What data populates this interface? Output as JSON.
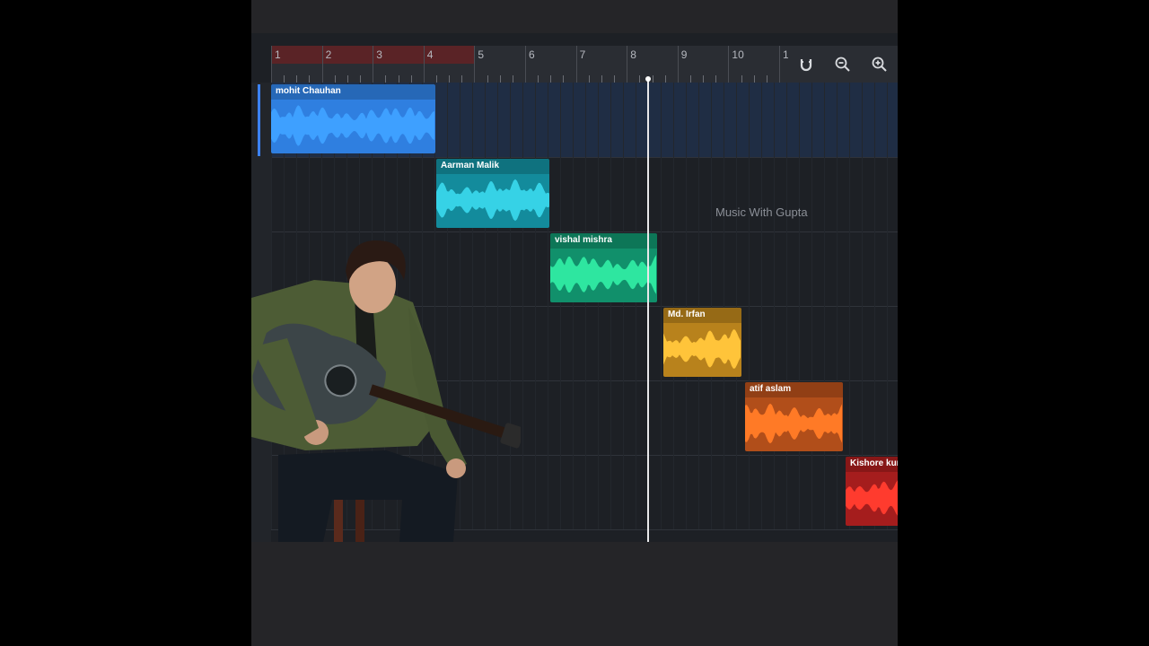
{
  "ruler": {
    "bars": [
      "1",
      "2",
      "3",
      "4",
      "5",
      "6",
      "7",
      "8",
      "9",
      "10",
      "11"
    ]
  },
  "tools": {
    "magnet_icon": "magnet-icon",
    "zoom_out_icon": "zoom-out-icon",
    "zoom_in_icon": "zoom-in-icon"
  },
  "watermark": "Music With Gupta",
  "playhead": {
    "bar": 8.4
  },
  "tracks": [
    {
      "name": "mohit Chauhan",
      "color": "#2f7fe0",
      "wave": "#3ea0ff"
    },
    {
      "name": "Aarman Malik",
      "color": "#138b9c",
      "wave": "#36d2e6"
    },
    {
      "name": "vishal mishra",
      "color": "#11906b",
      "wave": "#2ee6a0"
    },
    {
      "name": "Md. Irfan",
      "color": "#b8821c",
      "wave": "#ffc43a"
    },
    {
      "name": "atif aslam",
      "color": "#b14e1a",
      "wave": "#ff7a26"
    },
    {
      "name": "Kishore kur",
      "color": "#a51d1d",
      "wave": "#ff3b2e"
    }
  ]
}
